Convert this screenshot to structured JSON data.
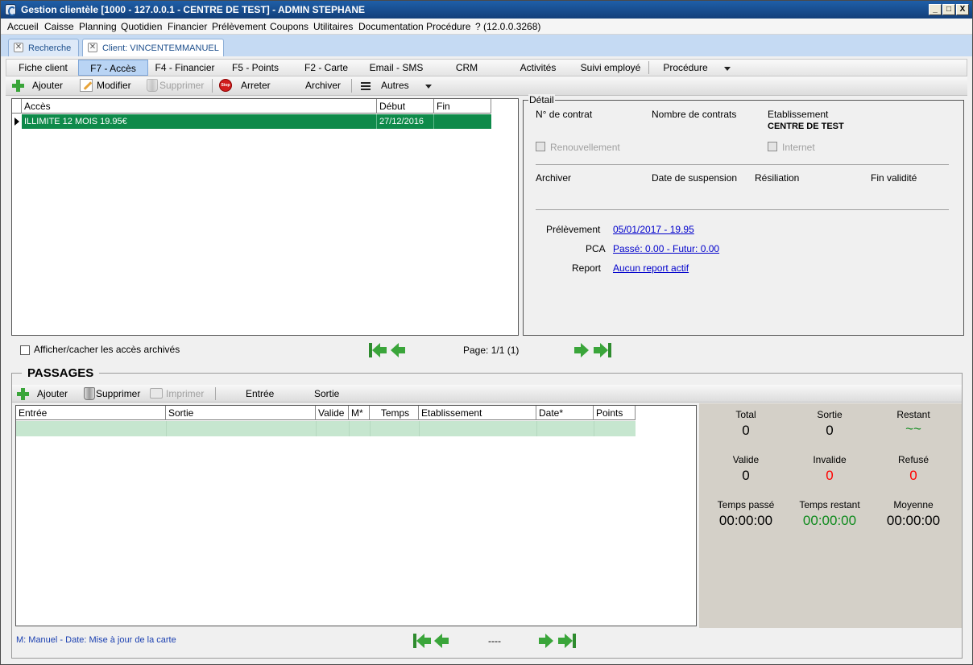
{
  "window": {
    "title": "Gestion clientèle [1000 - 127.0.0.1 - CENTRE DE TEST] - ADMIN STEPHANE",
    "buttons": {
      "minimize": "_",
      "maximize": "□",
      "close": "X"
    }
  },
  "menu": [
    "Accueil",
    "Caisse",
    "Planning",
    "Quotidien",
    "Financier",
    "Prélèvement",
    "Coupons",
    "Utilitaires",
    "Documentation",
    "Procédure",
    "? (12.0.0.3268)"
  ],
  "doc_tabs": [
    {
      "label": "Recherche",
      "active": false
    },
    {
      "label": "Client: VINCENTEMMANUEL",
      "active": true
    }
  ],
  "nav_tabs": [
    "Fiche client",
    "F7 - Accès",
    "F4 - Financier",
    "F5 - Points",
    "F2 - Carte",
    "Email - SMS",
    "CRM",
    "Activités",
    "Suivi employé",
    "Procédure"
  ],
  "toolbar": {
    "add": "Ajouter",
    "edit": "Modifier",
    "delete": "Supprimer",
    "stop": "Arreter",
    "stop_icon_text": "Stop",
    "archive": "Archiver",
    "other": "Autres"
  },
  "access_grid": {
    "columns": [
      "Accès",
      "Début",
      "Fin"
    ],
    "rows": [
      {
        "acces": "ILLIMITE 12 MOIS 19.95€",
        "debut": "27/12/2016",
        "fin": ""
      }
    ]
  },
  "detail": {
    "legend": "Détail",
    "contract_no_label": "N° de contrat",
    "contract_count_label": "Nombre de contrats",
    "etab_label": "Etablissement",
    "etab_value": "CENTRE DE TEST",
    "renewal_label": "Renouvellement",
    "internet_label": "Internet",
    "archive_label": "Archiver",
    "suspension_label": "Date de suspension",
    "termination_label": "Résiliation",
    "end_validity_label": "Fin validité",
    "debit_label": "Prélèvement",
    "debit_value": "05/01/2017 - 19.95",
    "pca_label": "PCA",
    "pca_value": "Passé: 0.00 - Futur: 0.00",
    "report_label": "Report",
    "report_value": "Aucun report actif"
  },
  "access_footer": {
    "toggle_archived": "Afficher/cacher les accès archivés",
    "page": "Page: 1/1 (1)"
  },
  "passages": {
    "title": "PASSAGES",
    "toolbar": {
      "add": "Ajouter",
      "delete": "Supprimer",
      "print": "Imprimer",
      "entry": "Entrée",
      "exit": "Sortie"
    },
    "columns": [
      "Entrée",
      "Sortie",
      "Valide",
      "M*",
      "Temps",
      "Etablissement",
      "Date*",
      "Points"
    ],
    "footer_note": "M: Manuel - Date: Mise à jour de la carte",
    "page": "----"
  },
  "stats": {
    "total_label": "Total",
    "total": "0",
    "exit_label": "Sortie",
    "exit": "0",
    "remaining_label": "Restant",
    "remaining": "~~",
    "valid_label": "Valide",
    "valid": "0",
    "invalid_label": "Invalide",
    "invalid": "0",
    "refused_label": "Refusé",
    "refused": "0",
    "time_spent_label": "Temps passé",
    "time_spent": "00:00:00",
    "time_left_label": "Temps restant",
    "time_left": "00:00:00",
    "average_label": "Moyenne",
    "average": "00:00:00"
  },
  "colors": {
    "selected_row": "#0e8a4a",
    "link": "#0000cc",
    "alert_red": "#ff0000",
    "positive_green": "#0d8a1c",
    "titlebar": "#1f5fa8"
  },
  "icons": {
    "add": "plus-icon",
    "edit": "pencil-icon",
    "delete": "trash-icon",
    "stop": "stop-icon",
    "other": "menu-icon",
    "print": "printer-icon",
    "nav_first": "first-page-icon",
    "nav_prev": "prev-page-icon",
    "nav_next": "next-page-icon",
    "nav_last": "last-page-icon"
  }
}
